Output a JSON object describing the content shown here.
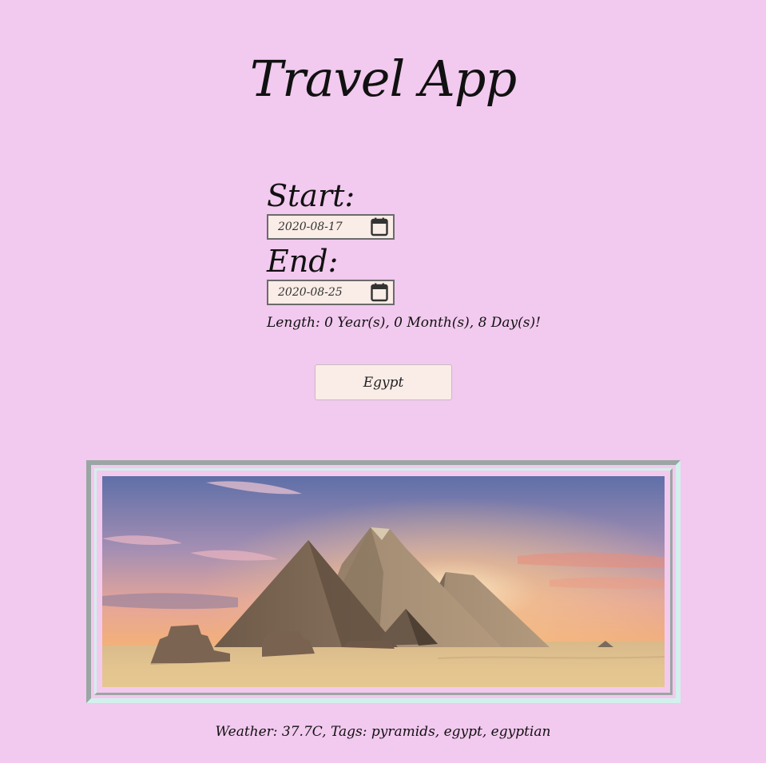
{
  "app": {
    "title": "Travel App"
  },
  "form": {
    "start_label": "Start:",
    "start_value": "2020-08-17",
    "end_label": "End:",
    "end_value": "2020-08-25",
    "length_text": "Length: 0 Year(s), 0 Month(s), 8 Day(s)!"
  },
  "destination_button": {
    "label": "Egypt"
  },
  "image": {
    "subject": "pyramids of Giza at sunset"
  },
  "info": {
    "text": "Weather: 37.7C, Tags: pyramids, egypt, egyptian"
  },
  "colors": {
    "background": "#f2c9ef",
    "input_bg": "#faece6",
    "frame_dark": "#9aa6a4",
    "frame_light": "#d2f0ec"
  },
  "icons": [
    "calendar-icon"
  ]
}
